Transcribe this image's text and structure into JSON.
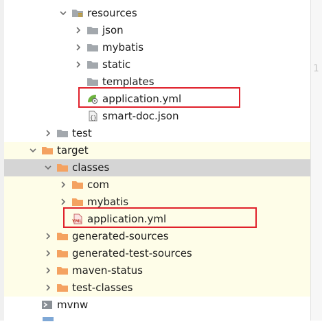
{
  "tree": {
    "rows": [
      {
        "label": "resources",
        "icon": "resources-folder-icon",
        "level": 3,
        "expanded": true,
        "bg": "white"
      },
      {
        "label": "json",
        "icon": "folder-icon",
        "level": 4,
        "expanded": false,
        "bg": "white"
      },
      {
        "label": "mybatis",
        "icon": "folder-icon",
        "level": 4,
        "expanded": false,
        "bg": "white"
      },
      {
        "label": "static",
        "icon": "folder-icon",
        "level": 4,
        "expanded": false,
        "bg": "white"
      },
      {
        "label": "templates",
        "icon": "folder-icon",
        "level": 4,
        "bg": "white"
      },
      {
        "label": "application.yml",
        "icon": "spring-config-icon",
        "level": 4,
        "bg": "white",
        "highlighted": true
      },
      {
        "label": "smart-doc.json",
        "icon": "json-file-icon",
        "level": 4,
        "bg": "white"
      },
      {
        "label": "test",
        "icon": "folder-icon",
        "level": 2,
        "expanded": false,
        "bg": "white"
      },
      {
        "label": "target",
        "icon": "excluded-folder-icon",
        "level": 1,
        "expanded": true,
        "bg": "yellow"
      },
      {
        "label": "classes",
        "icon": "excluded-folder-icon",
        "level": 2,
        "expanded": true,
        "bg": "selected"
      },
      {
        "label": "com",
        "icon": "excluded-folder-icon",
        "level": 3,
        "expanded": false,
        "bg": "yellow"
      },
      {
        "label": "mybatis",
        "icon": "excluded-folder-icon",
        "level": 3,
        "expanded": false,
        "bg": "yellow"
      },
      {
        "label": "application.yml",
        "icon": "yml-file-icon",
        "level": 3,
        "bg": "yellow",
        "highlighted": true
      },
      {
        "label": "generated-sources",
        "icon": "excluded-folder-icon",
        "level": 2,
        "expanded": false,
        "bg": "yellow"
      },
      {
        "label": "generated-test-sources",
        "icon": "excluded-folder-icon",
        "level": 2,
        "expanded": false,
        "bg": "yellow"
      },
      {
        "label": "maven-status",
        "icon": "excluded-folder-icon",
        "level": 2,
        "expanded": false,
        "bg": "yellow"
      },
      {
        "label": "test-classes",
        "icon": "excluded-folder-icon",
        "level": 2,
        "expanded": false,
        "bg": "yellow"
      },
      {
        "label": "mvnw",
        "icon": "script-file-icon",
        "level": 1,
        "bg": "white"
      }
    ]
  },
  "editor": {
    "line_number": "1"
  },
  "colors": {
    "folder_gray": "#a3a8ad",
    "folder_orange": "#f4a261",
    "excluded_bg": "#fefde8",
    "selected_bg": "#d5d5d5",
    "highlight_box": "#e0202a"
  }
}
